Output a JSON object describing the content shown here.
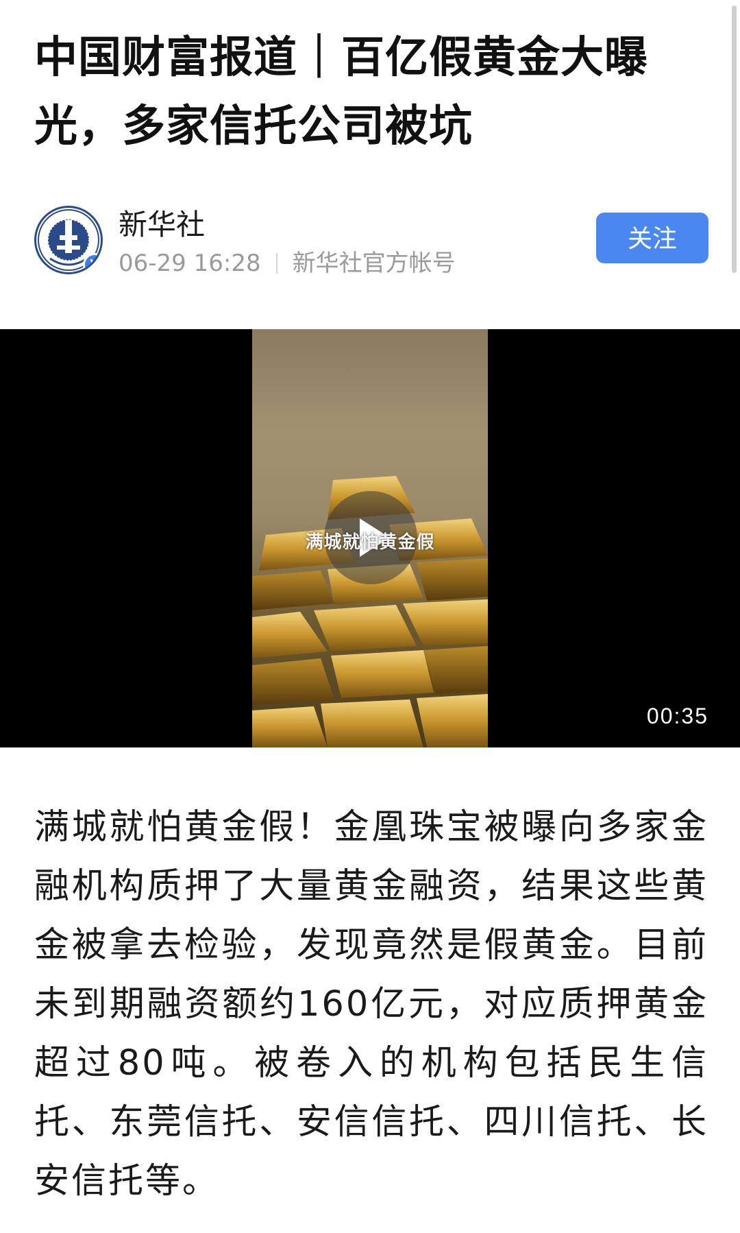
{
  "article": {
    "title": "中国财富报道｜百亿假黄金大曝光，多家信托公司被坑",
    "body": "满城就怕黄金假！金凰珠宝被曝向多家金融机构质押了大量黄金融资，结果这些黄金被拿去检验，发现竟然是假黄金。目前未到期融资额约160亿元，对应质押黄金超过80吨。被卷入的机构包括民生信托、东莞信托、安信信托、四川信托、长安信托等。"
  },
  "author": {
    "name": "新华社",
    "timestamp": "06-29 16:28",
    "account_type": "新华社官方帐号",
    "avatar_icon": "xinhua-logo-icon",
    "verified_icon": "verified-badge-icon",
    "verified_glyph": "V",
    "follow_label": "关注"
  },
  "video": {
    "caption": "满城就怕黄金假",
    "duration": "00:35",
    "play_icon": "play-icon"
  },
  "colors": {
    "accent": "#4a87f0",
    "verified": "#3d7fe0",
    "meta_text": "#9a9a9a",
    "logo_blue": "#2a4a8a"
  }
}
